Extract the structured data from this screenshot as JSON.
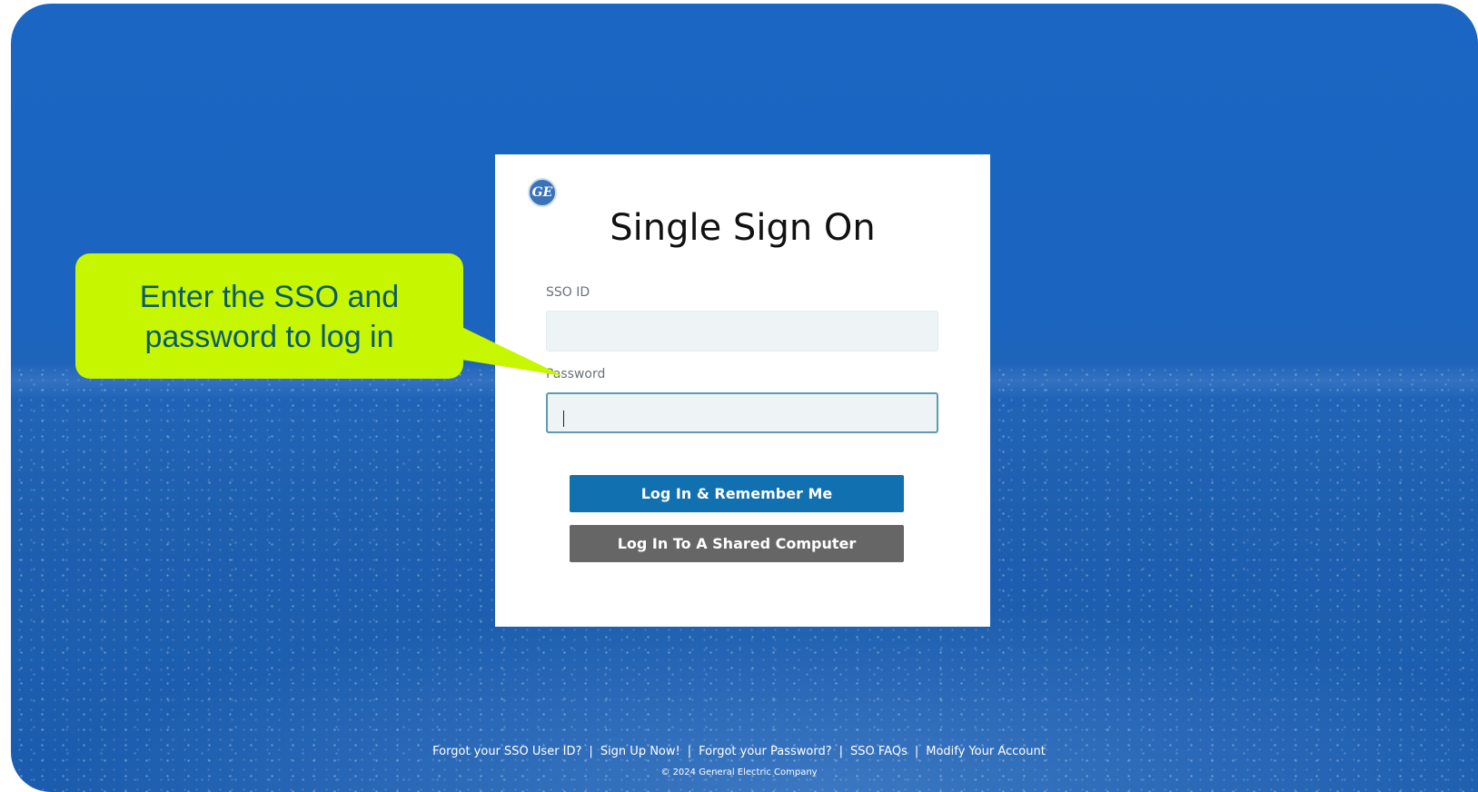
{
  "card": {
    "logo_text": "GE",
    "title": "Single Sign On",
    "sso_label": "SSO ID",
    "sso_value": "",
    "password_label": "Password",
    "password_value": "",
    "login_remember_label": "Log In & Remember Me",
    "login_shared_label": "Log In To A Shared Computer"
  },
  "footer": {
    "links": [
      "Forgot your SSO User ID?",
      "Sign Up Now!",
      "Forgot your Password?",
      "SSO FAQs",
      "Modify Your Account"
    ],
    "separator": "|",
    "copyright": "© 2024 General Electric Company"
  },
  "callout": {
    "line1": "Enter the SSO and",
    "line2": "password to log in"
  },
  "colors": {
    "background": "#1b64bf",
    "primary_button": "#1170b0",
    "secondary_button": "#666666",
    "callout": "#c6f600",
    "callout_text": "#0a5b69"
  }
}
